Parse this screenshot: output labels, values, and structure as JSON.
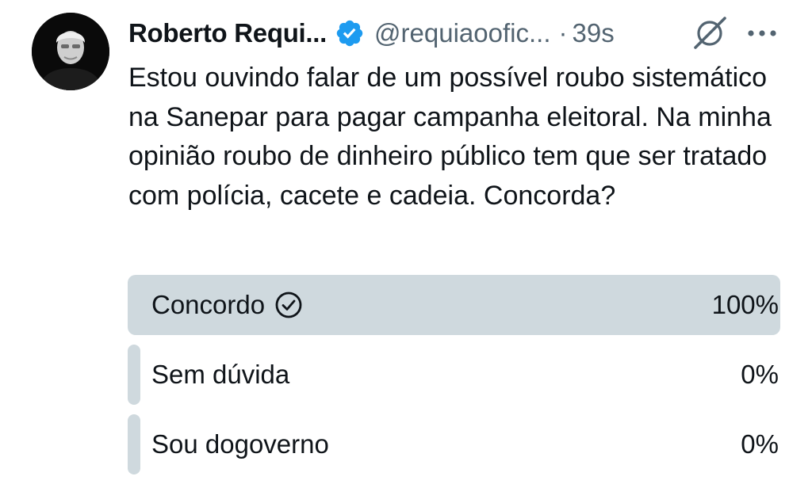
{
  "author": {
    "name": "Roberto Requi...",
    "handle": "@requiaooﬁc...",
    "separator": "·",
    "time": "39s"
  },
  "icons": {
    "verified": "verified-badge-icon",
    "grok": "grok-icon",
    "more": "more-options-icon",
    "check": "check-circle-icon"
  },
  "colors": {
    "verified": "#1d9bf0",
    "poll_fill": "#cfd9de",
    "secondary_text": "#536471"
  },
  "tweet": {
    "text": "Estou ouvindo falar de um possível roubo sistemático na Sanepar para pagar campanha eleitoral. Na minha opinião roubo de dinheiro público tem que ser tratado com polícia, cacete e cadeia. Concorda?"
  },
  "poll": {
    "options": [
      {
        "label": "Concordo",
        "percent_text": "100%",
        "share": 1.0,
        "winner": true
      },
      {
        "label": "Sem dúvida",
        "percent_text": "0%",
        "share": 0.0,
        "winner": false
      },
      {
        "label": "Sou dogoverno",
        "percent_text": "0%",
        "share": 0.0,
        "winner": false
      }
    ]
  }
}
